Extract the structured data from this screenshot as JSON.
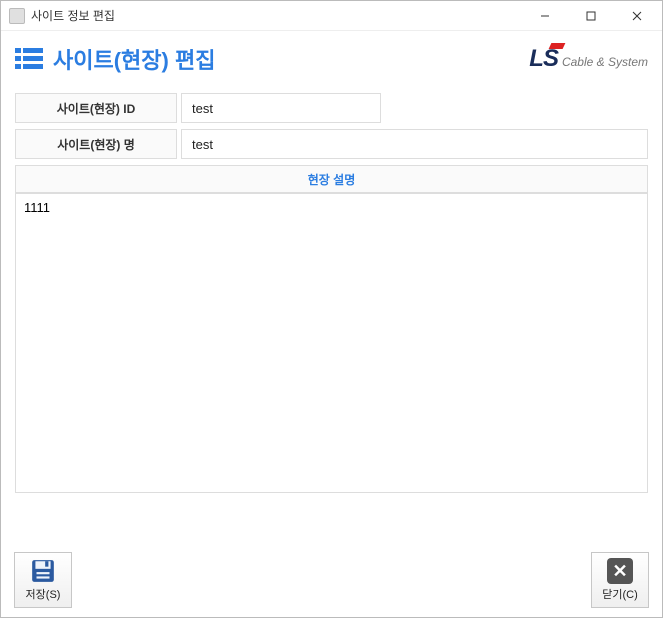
{
  "window": {
    "title": "사이트 정보 편집"
  },
  "header": {
    "title": "사이트(현장) 편집",
    "logo_main": "LS",
    "logo_sub": "Cable & System"
  },
  "form": {
    "site_id_label": "사이트(현장) ID",
    "site_id_value": "test",
    "site_name_label": "사이트(현장) 명",
    "site_name_value": "test",
    "desc_label": "현장 설명",
    "desc_value": "1111"
  },
  "footer": {
    "save_label": "저장(S)",
    "close_label": "닫기(C)"
  }
}
